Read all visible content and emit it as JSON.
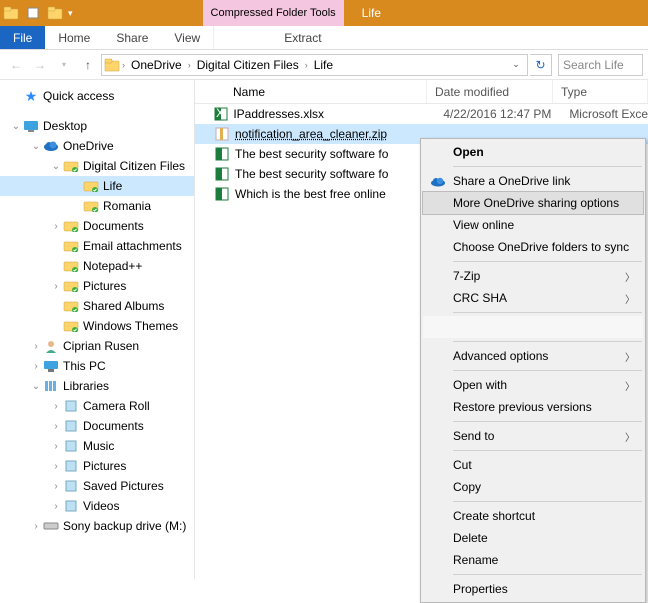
{
  "title": "Life",
  "context_tab": "Compressed Folder Tools",
  "ribbon": {
    "file": "File",
    "home": "Home",
    "share": "Share",
    "view": "View",
    "extract": "Extract"
  },
  "breadcrumb": [
    "OneDrive",
    "Digital Citizen Files",
    "Life"
  ],
  "search_placeholder": "Search Life",
  "tree": {
    "quick_access": "Quick access",
    "desktop": "Desktop",
    "onedrive": "OneDrive",
    "dcf": "Digital Citizen Files",
    "life": "Life",
    "romania": "Romania",
    "documents": "Documents",
    "email": "Email attachments",
    "notepad": "Notepad++",
    "pictures": "Pictures",
    "shared": "Shared Albums",
    "themes": "Windows Themes",
    "ciprian": "Ciprian Rusen",
    "thispc": "This PC",
    "libraries": "Libraries",
    "camera": "Camera Roll",
    "ldocs": "Documents",
    "music": "Music",
    "lpics": "Pictures",
    "saved": "Saved Pictures",
    "videos": "Videos",
    "sony": "Sony backup drive (M:)"
  },
  "cols": {
    "name": "Name",
    "date": "Date modified",
    "type": "Type"
  },
  "rows": [
    {
      "name": "IPaddresses.xlsx",
      "date": "4/22/2016 12:47 PM",
      "type": "Microsoft Exce"
    },
    {
      "name": "notification_area_cleaner.zip",
      "date": "",
      "type": ""
    },
    {
      "name": "The best security software fo",
      "date": "",
      "type": ""
    },
    {
      "name": "The best security software fo",
      "date": "",
      "type": ""
    },
    {
      "name": "Which is the best free online",
      "date": "",
      "type": ""
    }
  ],
  "menu": {
    "open": "Open",
    "share": "Share a OneDrive link",
    "more": "More OneDrive sharing options",
    "view": "View online",
    "choose": "Choose OneDrive folders to sync",
    "zip": "7-Zip",
    "crc": "CRC SHA",
    "adv": "Advanced options",
    "openwith": "Open with",
    "restore": "Restore previous versions",
    "sendto": "Send to",
    "cut": "Cut",
    "copy": "Copy",
    "shortcut": "Create shortcut",
    "delete": "Delete",
    "rename": "Rename",
    "props": "Properties"
  }
}
